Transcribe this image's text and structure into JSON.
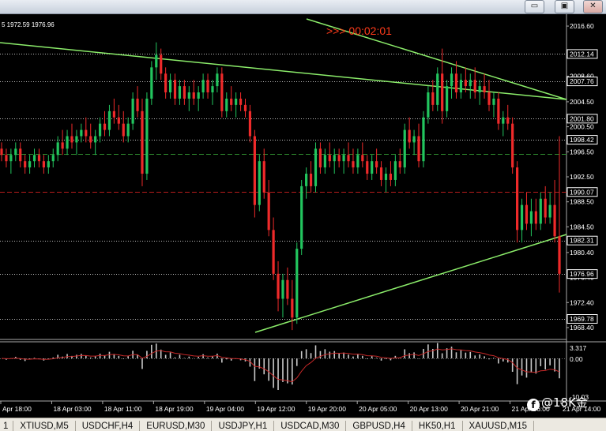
{
  "window": {
    "minimize_glyph": "▭",
    "restore_glyph": "▣",
    "close_glyph": "✕"
  },
  "chart": {
    "ohlc_label": "5 1972.59 1976.96",
    "timer": ">>> 00:02:01",
    "y_min": 1966.5,
    "y_max": 2018.5,
    "colors": {
      "bull": "#22c55e",
      "bear": "#ef2a2a",
      "trendline": "#8bec6a",
      "grid": "#4b4b4b",
      "level_green": "#2e8b2e",
      "level_red": "#b71c1c",
      "oscillator": "#c9c9c9",
      "signal": "#c62828",
      "marker_bg": "#000000",
      "marker_border": "#ffffff"
    }
  },
  "chart_data": {
    "type": "candlestick",
    "price_ticks": [
      2016.6,
      2012.3,
      2008.6,
      2004.5,
      2000.5,
      1996.5,
      1992.5,
      1988.5,
      1984.5,
      1980.4,
      1976.4,
      1972.4,
      1968.4
    ],
    "price_tick_labels": [
      "2016.60",
      "",
      "2008.60",
      "2004.50",
      "2000.50",
      "1996.50",
      "1992.50",
      "1988.50",
      "1984.50",
      "1980.40",
      "1976.40",
      "1972.40",
      "1968.40"
    ],
    "level_markers": [
      {
        "value": 2012.14,
        "label": "2012.14"
      },
      {
        "value": 2007.76,
        "label": "2007.76"
      },
      {
        "value": 2001.8,
        "label": "2001.80"
      },
      {
        "value": 1998.42,
        "label": "1998.42"
      },
      {
        "value": 1990.07,
        "label": "1990.07"
      },
      {
        "value": 1982.31,
        "label": "1982.31"
      },
      {
        "value": 1976.96,
        "label": "1976.96"
      },
      {
        "value": 1969.78,
        "label": "1969.78"
      }
    ],
    "horizontal_lines": [
      {
        "value": 2012.14,
        "style": "dotted",
        "color": "white"
      },
      {
        "value": 2007.76,
        "style": "dotted",
        "color": "white"
      },
      {
        "value": 2001.8,
        "style": "dotted",
        "color": "white"
      },
      {
        "value": 1998.42,
        "style": "dotted",
        "color": "white"
      },
      {
        "value": 1996.1,
        "style": "dashed",
        "color": "green"
      },
      {
        "value": 1990.07,
        "style": "dashed",
        "color": "red"
      },
      {
        "value": 1982.31,
        "style": "dotted",
        "color": "white"
      },
      {
        "value": 1976.96,
        "style": "dotted",
        "color": "white"
      },
      {
        "value": 1969.78,
        "style": "dotted",
        "color": "white"
      }
    ],
    "time_labels": [
      "Apr 18:00",
      "18 Apr 03:00",
      "18 Apr 11:00",
      "18 Apr 19:00",
      "19 Apr 04:00",
      "19 Apr 12:00",
      "19 Apr 20:00",
      "20 Apr 05:00",
      "20 Apr 13:00",
      "20 Apr 21:00",
      "21 Apr 06:00",
      "21 Apr 14:00"
    ],
    "indicator": {
      "ticks": [
        3.317,
        0.0
      ],
      "tick_labels": [
        "3.317",
        "0.00"
      ],
      "bottom_label": "-10.03"
    },
    "candles": [
      [
        1997,
        1998,
        1995,
        1996
      ],
      [
        1996,
        1997,
        1994,
        1995
      ],
      [
        1995,
        1997,
        1993,
        1996
      ],
      [
        1996,
        1998,
        1995,
        1997
      ],
      [
        1997,
        1998,
        1994,
        1995
      ],
      [
        1995,
        1996,
        1993,
        1994
      ],
      [
        1994,
        1996,
        1993,
        1995
      ],
      [
        1995,
        1997,
        1994,
        1996
      ],
      [
        1996,
        1997,
        1994,
        1995
      ],
      [
        1995,
        1996,
        1993,
        1994
      ],
      [
        1994,
        1996,
        1993,
        1995
      ],
      [
        1995,
        1997,
        1994,
        1996
      ],
      [
        1996,
        1999,
        1995,
        1998
      ],
      [
        1998,
        2000,
        1996,
        1997
      ],
      [
        1997,
        2000,
        1996,
        1999
      ],
      [
        1999,
        2001,
        1997,
        1998
      ],
      [
        1998,
        2000,
        1996,
        1999
      ],
      [
        1999,
        2001,
        1998,
        2000
      ],
      [
        2000,
        2002,
        1998,
        1999
      ],
      [
        1999,
        2001,
        1997,
        1998
      ],
      [
        1998,
        2000,
        1996,
        1999
      ],
      [
        1999,
        2002,
        1998,
        2001
      ],
      [
        2001,
        2003,
        1999,
        2000
      ],
      [
        2000,
        2004,
        1999,
        2003
      ],
      [
        2003,
        2005,
        2001,
        2002
      ],
      [
        2002,
        2004,
        2000,
        2001
      ],
      [
        2001,
        2003,
        1998,
        1999
      ],
      [
        1999,
        2002,
        1998,
        2001
      ],
      [
        2001,
        2006,
        2000,
        2005
      ],
      [
        2005,
        2007,
        2002,
        2003
      ],
      [
        2003,
        2005,
        1991,
        1993
      ],
      [
        1993,
        2006,
        1992,
        2005
      ],
      [
        2005,
        2011,
        2004,
        2010
      ],
      [
        2010,
        2014,
        2008,
        2012
      ],
      [
        2012,
        2013,
        2008,
        2009
      ],
      [
        2009,
        2010,
        2005,
        2006
      ],
      [
        2006,
        2009,
        2005,
        2008
      ],
      [
        2008,
        2009,
        2004,
        2005
      ],
      [
        2005,
        2008,
        2004,
        2007
      ],
      [
        2007,
        2008,
        2004,
        2005
      ],
      [
        2005,
        2007,
        2003,
        2006
      ],
      [
        2006,
        2008,
        2004,
        2005
      ],
      [
        2005,
        2007,
        2003,
        2006
      ],
      [
        2006,
        2009,
        2005,
        2008
      ],
      [
        2008,
        2009,
        2005,
        2006
      ],
      [
        2006,
        2008,
        2004,
        2007
      ],
      [
        2007,
        2010,
        2006,
        2009
      ],
      [
        2009,
        2010,
        2002,
        2003
      ],
      [
        2003,
        2006,
        2002,
        2005
      ],
      [
        2005,
        2007,
        2003,
        2004
      ],
      [
        2004,
        2006,
        2002,
        2005
      ],
      [
        2005,
        2006,
        2003,
        2004
      ],
      [
        2004,
        2005,
        2002,
        2003
      ],
      [
        2003,
        2004,
        1998,
        1999
      ],
      [
        1999,
        2000,
        1986,
        1988
      ],
      [
        1988,
        1996,
        1987,
        1995
      ],
      [
        1995,
        1997,
        1989,
        1990
      ],
      [
        1990,
        1992,
        1983,
        1984
      ],
      [
        1984,
        1986,
        1976,
        1977
      ],
      [
        1977,
        1979,
        1971,
        1973
      ],
      [
        1973,
        1977,
        1970,
        1976
      ],
      [
        1976,
        1978,
        1972,
        1973
      ],
      [
        1973,
        1976,
        1968,
        1970
      ],
      [
        1970,
        1982,
        1969,
        1981
      ],
      [
        1981,
        1992,
        1980,
        1991
      ],
      [
        1991,
        1994,
        1989,
        1993
      ],
      [
        1993,
        1995,
        1990,
        1991
      ],
      [
        1991,
        1998,
        1990,
        1997
      ],
      [
        1997,
        1998,
        1993,
        1994
      ],
      [
        1994,
        1997,
        1993,
        1996
      ],
      [
        1996,
        1998,
        1994,
        1995
      ],
      [
        1995,
        1997,
        1993,
        1996
      ],
      [
        1996,
        1997,
        1994,
        1995
      ],
      [
        1995,
        1997,
        1993,
        1996
      ],
      [
        1996,
        1998,
        1994,
        1995
      ],
      [
        1995,
        1997,
        1993,
        1994
      ],
      [
        1994,
        1997,
        1993,
        1996
      ],
      [
        1996,
        1998,
        1994,
        1995
      ],
      [
        1995,
        1996,
        1992,
        1993
      ],
      [
        1993,
        1996,
        1992,
        1995
      ],
      [
        1995,
        1997,
        1993,
        1994
      ],
      [
        1994,
        1995,
        1991,
        1992
      ],
      [
        1992,
        1994,
        1990,
        1993
      ],
      [
        1993,
        1995,
        1991,
        1992
      ],
      [
        1992,
        1996,
        1991,
        1995
      ],
      [
        1995,
        1997,
        1993,
        1994
      ],
      [
        1994,
        2001,
        1993,
        2000
      ],
      [
        2000,
        2002,
        1997,
        1998
      ],
      [
        1998,
        2000,
        1996,
        1999
      ],
      [
        1999,
        2001,
        1994,
        1995
      ],
      [
        1995,
        2003,
        1994,
        2002
      ],
      [
        2002,
        2007,
        2001,
        2006
      ],
      [
        2006,
        2008,
        2003,
        2004
      ],
      [
        2004,
        2010,
        2003,
        2009
      ],
      [
        2009,
        2013,
        2001,
        2003
      ],
      [
        2003,
        2008,
        2002,
        2007
      ],
      [
        2007,
        2010,
        2005,
        2009
      ],
      [
        2009,
        2011,
        2005,
        2006
      ],
      [
        2006,
        2009,
        2005,
        2008
      ],
      [
        2008,
        2010,
        2006,
        2007
      ],
      [
        2007,
        2009,
        2005,
        2008
      ],
      [
        2008,
        2010,
        2005,
        2006
      ],
      [
        2006,
        2008,
        2004,
        2007
      ],
      [
        2007,
        2009,
        2005,
        2006
      ],
      [
        2006,
        2008,
        2003,
        2004
      ],
      [
        2004,
        2006,
        2002,
        2005
      ],
      [
        2005,
        2006,
        2000,
        2001
      ],
      [
        2001,
        2003,
        1999,
        2002
      ],
      [
        2002,
        2004,
        2000,
        2001
      ],
      [
        2001,
        2002,
        1993,
        1994
      ],
      [
        1994,
        1995,
        1982,
        1984
      ],
      [
        1984,
        1989,
        1982,
        1988
      ],
      [
        1988,
        1990,
        1984,
        1985
      ],
      [
        1985,
        1989,
        1983,
        1987
      ],
      [
        1987,
        1989,
        1984,
        1985
      ],
      [
        1985,
        1990,
        1984,
        1989
      ],
      [
        1989,
        1991,
        1985,
        1986
      ],
      [
        1986,
        1990,
        1985,
        1988
      ],
      [
        1988,
        1992,
        1982,
        1983
      ],
      [
        1983,
        1999,
        1974,
        1977
      ]
    ]
  }
}
